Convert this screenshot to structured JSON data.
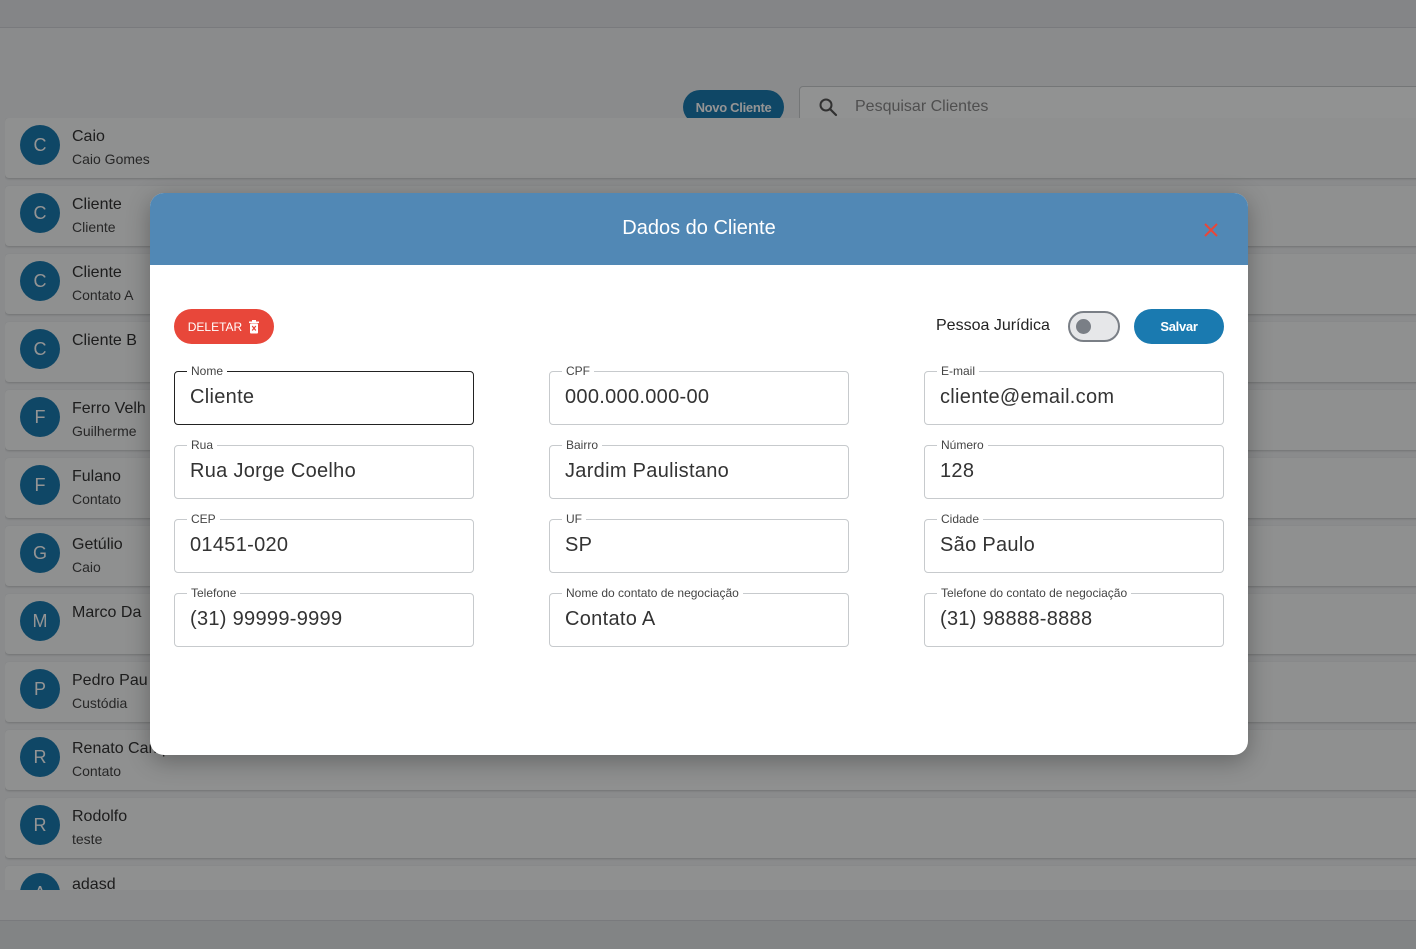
{
  "toolbar": {
    "new_client_label": "Novo Cliente",
    "search_placeholder": "Pesquisar Clientes"
  },
  "clients": [
    {
      "initial": "C",
      "name": "Caio",
      "sub": "Caio Gomes"
    },
    {
      "initial": "C",
      "name": "Cliente",
      "sub": "Cliente"
    },
    {
      "initial": "C",
      "name": "Cliente",
      "sub": "Contato A"
    },
    {
      "initial": "C",
      "name": "Cliente B",
      "sub": ""
    },
    {
      "initial": "F",
      "name": "Ferro Velh",
      "sub": "Guilherme"
    },
    {
      "initial": "F",
      "name": "Fulano",
      "sub": "Contato"
    },
    {
      "initial": "G",
      "name": "Getúlio",
      "sub": "Caio"
    },
    {
      "initial": "M",
      "name": "Marco Da",
      "sub": ""
    },
    {
      "initial": "P",
      "name": "Pedro Pau",
      "sub": "Custódia"
    },
    {
      "initial": "R",
      "name": "Renato Campos",
      "sub": "Contato"
    },
    {
      "initial": "R",
      "name": "Rodolfo",
      "sub": "teste"
    },
    {
      "initial": "A",
      "name": "adasd",
      "sub": ""
    }
  ],
  "modal": {
    "title": "Dados do Cliente",
    "delete_label": "DELETAR",
    "pj_label": "Pessoa Jurídica",
    "pj_enabled": false,
    "save_label": "Salvar",
    "fields": {
      "nome": {
        "label": "Nome",
        "value": "Cliente"
      },
      "cpf": {
        "label": "CPF",
        "value": "000.000.000-00"
      },
      "email": {
        "label": "E-mail",
        "value": "cliente@email.com"
      },
      "rua": {
        "label": "Rua",
        "value": "Rua Jorge Coelho"
      },
      "bairro": {
        "label": "Bairro",
        "value": "Jardim Paulistano"
      },
      "numero": {
        "label": "Número",
        "value": "128"
      },
      "cep": {
        "label": "CEP",
        "value": "01451-020"
      },
      "uf": {
        "label": "UF",
        "value": "SP"
      },
      "cidade": {
        "label": "Cidade",
        "value": "São Paulo"
      },
      "telefone": {
        "label": "Telefone",
        "value": "(31) 99999-9999"
      },
      "contato_nome": {
        "label": "Nome do contato de negociação",
        "value": "Contato A"
      },
      "contato_telefone": {
        "label": "Telefone do contato de negociação",
        "value": "(31) 98888-8888"
      }
    }
  },
  "colors": {
    "primary": "#1a7ab0",
    "header": "#5188b5",
    "danger": "#e8473a"
  }
}
